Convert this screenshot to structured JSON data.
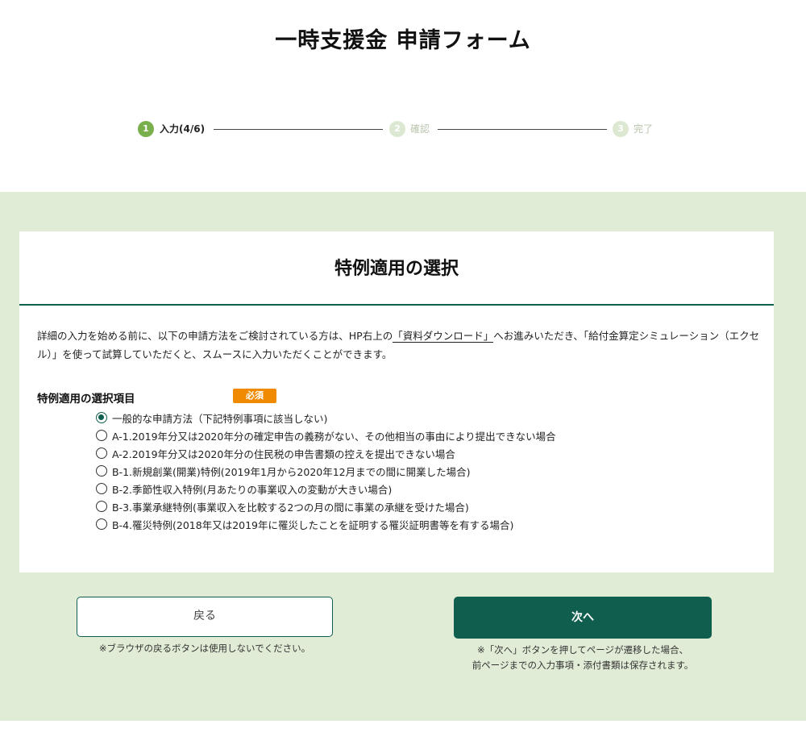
{
  "header": {
    "title": "一時支援金 申請フォーム"
  },
  "stepper": {
    "steps": [
      {
        "number": "1",
        "label": "入力(4/6)",
        "state": "active"
      },
      {
        "number": "2",
        "label": "確認",
        "state": "inactive"
      },
      {
        "number": "3",
        "label": "完了",
        "state": "inactive"
      }
    ]
  },
  "card": {
    "title": "特例適用の選択",
    "intro_part1": "詳細の入力を始める前に、以下の申請方法をご検討されている方は、HP右上の",
    "intro_link": "「資料ダウンロード」",
    "intro_part2": "へお進みいただき、「給付金算定シミュレーション（エクセル）」を使って試算していただくと、スムースに入力いただくことができます。",
    "field_label": "特例適用の選択項目",
    "required_badge": "必須",
    "options": [
      {
        "label": "一般的な申請方法（下記特例事項に該当しない)",
        "checked": true
      },
      {
        "label": "A-1.2019年分又は2020年分の確定申告の義務がない、その他相当の事由により提出できない場合",
        "checked": false
      },
      {
        "label": "A-2.2019年分又は2020年分の住民税の申告書類の控えを提出できない場合",
        "checked": false
      },
      {
        "label": "B-1.新規創業(開業)特例(2019年1月から2020年12月までの間に開業した場合)",
        "checked": false
      },
      {
        "label": "B-2.季節性収入特例(月あたりの事業収入の変動が大きい場合)",
        "checked": false
      },
      {
        "label": "B-3.事業承継特例(事業収入を比較する2つの月の間に事業の承継を受けた場合)",
        "checked": false
      },
      {
        "label": "B-4.罹災特例(2018年又は2019年に罹災したことを証明する罹災証明書等を有する場合)",
        "checked": false
      }
    ]
  },
  "footer": {
    "back_label": "戻る",
    "back_note": "※ブラウザの戻るボタンは使用しないでください。",
    "next_label": "次へ",
    "next_note_line1": "※「次へ」ボタンを押してページが遷移した場合、",
    "next_note_line2": "前ページまでの入力事項・添付書類は保存されます。"
  },
  "colors": {
    "primary": "#0f5e4e",
    "step_active": "#7ab04c",
    "band": "#e1ecd6",
    "required": "#f08a00"
  }
}
